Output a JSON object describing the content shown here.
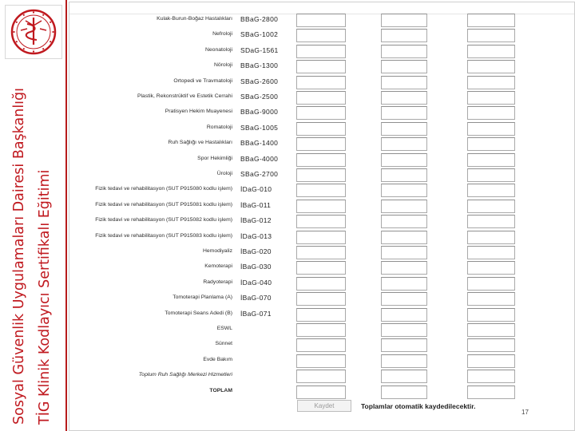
{
  "branding": {
    "title_line_1": "Sosyal Güvenlik Uygulamaları Dairesi Başkanlığı",
    "title_line_2": "TİG Klinik Kodlayıcı Sertifikalı Eğitimi",
    "accent_color": "#c0191f",
    "logo_icon": "health-ministry-emblem-icon"
  },
  "rows": [
    {
      "label": "Kulak-Burun-Boğaz Hastalıkları",
      "code": "BBaG-2800",
      "style": "normal"
    },
    {
      "label": "Nefroloji",
      "code": "SBaG-1002",
      "style": "normal"
    },
    {
      "label": "Neonatoloji",
      "code": "SDaG-1561",
      "style": "normal"
    },
    {
      "label": "Nöroloji",
      "code": "BBaG-1300",
      "style": "normal"
    },
    {
      "label": "Ortopedi ve Travmatoloji",
      "code": "SBaG-2600",
      "style": "normal"
    },
    {
      "label": "Plastik, Rekonstrüktif ve Estetik Cerrahi",
      "code": "SBaG-2500",
      "style": "normal"
    },
    {
      "label": "Pratisyen Hekim Muayenesi",
      "code": "BBaG-9000",
      "style": "normal"
    },
    {
      "label": "Romatoloji",
      "code": "SBaG-1005",
      "style": "normal"
    },
    {
      "label": "Ruh Sağlığı ve Hastalıkları",
      "code": "BBaG-1400",
      "style": "normal"
    },
    {
      "label": "Spor Hekimliği",
      "code": "BBaG-4000",
      "style": "normal"
    },
    {
      "label": "Üroloji",
      "code": "SBaG-2700",
      "style": "normal"
    },
    {
      "label": "Fizik tedavi ve rehabilitasyon (SUT P915080 kodlu işlem)",
      "code": "İDaG-010",
      "style": "normal"
    },
    {
      "label": "Fizik tedavi ve rehabilitasyon (SUT P915081 kodlu işlem)",
      "code": "İBaG-011",
      "style": "normal"
    },
    {
      "label": "Fizik tedavi ve rehabilitasyon (SUT P915082 kodlu işlem)",
      "code": "İBaG-012",
      "style": "normal"
    },
    {
      "label": "Fizik tedavi ve rehabilitasyon (SUT P915083 kodlu işlem)",
      "code": "İDaG-013",
      "style": "normal"
    },
    {
      "label": "Hemodiyaliz",
      "code": "İBaG-020",
      "style": "normal"
    },
    {
      "label": "Kemoterapi",
      "code": "İBaG-030",
      "style": "normal"
    },
    {
      "label": "Radyoterapi",
      "code": "İDaG-040",
      "style": "normal"
    },
    {
      "label": "Tomoterapi Planlama (A)",
      "code": "İBaG-070",
      "style": "normal"
    },
    {
      "label": "Tomoterapi Seans Adedi (B)",
      "code": "İBaG-071",
      "style": "normal"
    },
    {
      "label": "ESWL",
      "code": "",
      "style": "normal"
    },
    {
      "label": "Sünnet",
      "code": "",
      "style": "normal"
    },
    {
      "label": "Evde Bakım",
      "code": "",
      "style": "normal"
    },
    {
      "label": "Toplum Ruh Sağlığı Merkezi Hizmetleri",
      "code": "",
      "style": "italic"
    },
    {
      "label": "TOPLAM",
      "code": "",
      "style": "total"
    }
  ],
  "save_button_label": "Kaydet",
  "auto_save_note": "Toplamlar otomatik kaydedilecektir.",
  "page_number": "17"
}
